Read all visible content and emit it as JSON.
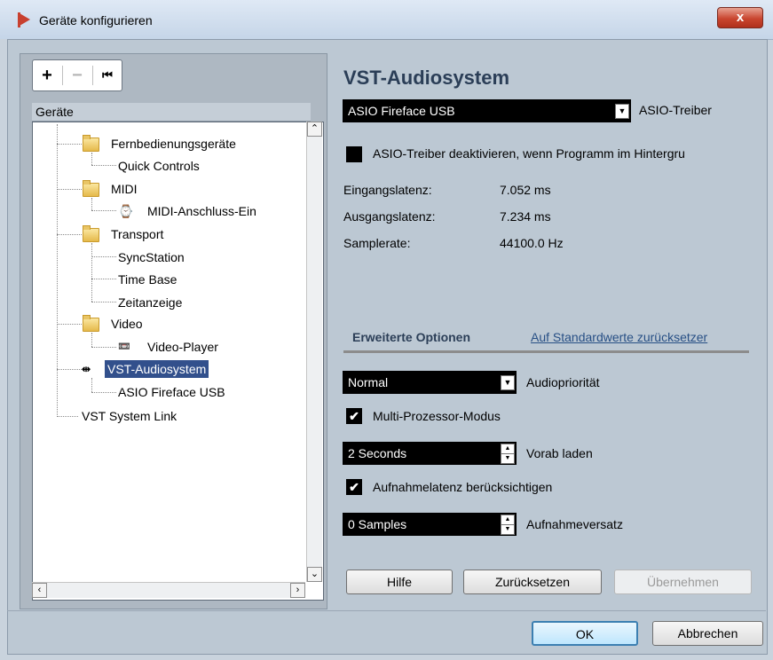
{
  "window": {
    "title": "Geräte konfigurieren",
    "close_label": "x"
  },
  "toolbar": {
    "add_label": "+",
    "remove_label": "−",
    "reset_label": "⏮"
  },
  "tree": {
    "header": "Geräte",
    "items": [
      {
        "label": "Fernbedienungsgeräte"
      },
      {
        "label": "Quick Controls"
      },
      {
        "label": "MIDI"
      },
      {
        "label": "MIDI-Anschluss-Ein"
      },
      {
        "label": "Transport"
      },
      {
        "label": "SyncStation"
      },
      {
        "label": "Time Base"
      },
      {
        "label": "Zeitanzeige"
      },
      {
        "label": "Video"
      },
      {
        "label": "Video-Player"
      },
      {
        "label": "VST-Audiosystem"
      },
      {
        "label": "ASIO Fireface USB"
      },
      {
        "label": "VST System Link"
      }
    ]
  },
  "panel": {
    "title": "VST-Audiosystem",
    "driver": {
      "value": "ASIO Fireface USB",
      "label": "ASIO-Treiber"
    },
    "deactivate_label": "ASIO-Treiber deaktivieren, wenn Programm im Hintergru",
    "info": [
      {
        "label": "Eingangslatenz:",
        "value": "7.052 ms"
      },
      {
        "label": "Ausgangslatenz:",
        "value": "7.234 ms"
      },
      {
        "label": "Samplerate:",
        "value": "44100.0 Hz"
      }
    ],
    "advanced": {
      "tab_label": "Erweiterte Optionen",
      "defaults_link": "Auf Standardwerte zurücksetzer",
      "priority": {
        "value": "Normal",
        "label": "Audiopriorität"
      },
      "multiprocessor_label": "Multi-Prozessor-Modus",
      "preload": {
        "value": "2 Seconds",
        "label": "Vorab laden"
      },
      "latency_label": "Aufnahmelatenz berücksichtigen",
      "offset": {
        "value": "0 Samples",
        "label": "Aufnahmeversatz"
      }
    },
    "buttons": {
      "help": "Hilfe",
      "reset": "Zurücksetzen",
      "apply": "Übernehmen"
    }
  },
  "footer": {
    "ok": "OK",
    "cancel": "Abbrechen"
  }
}
